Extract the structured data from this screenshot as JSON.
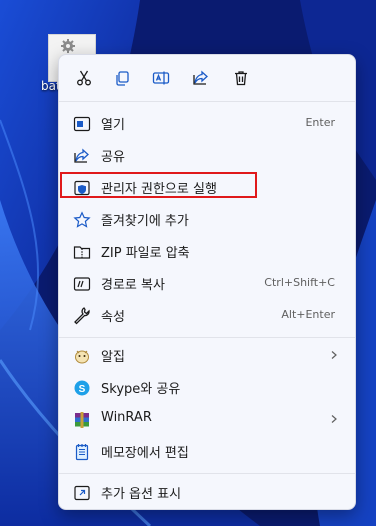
{
  "desktop": {
    "file_label": "bat",
    "file_icon": "gear-settings-file-icon"
  },
  "toolbar": [
    {
      "name": "cut",
      "icon": "scissors-icon"
    },
    {
      "name": "copy",
      "icon": "copy-icon"
    },
    {
      "name": "rename",
      "icon": "rename-icon"
    },
    {
      "name": "share",
      "icon": "share-icon"
    },
    {
      "name": "delete",
      "icon": "trash-icon"
    }
  ],
  "menu": {
    "open": {
      "label": "열기",
      "shortcut": "Enter",
      "icon": "open-app-icon"
    },
    "share": {
      "label": "공유",
      "icon": "share-icon"
    },
    "run_as_admin": {
      "label": "관리자 권한으로 실행",
      "icon": "shield-icon"
    },
    "add_favorites": {
      "label": "즐겨찾기에 추가",
      "icon": "star-icon"
    },
    "zip": {
      "label": "ZIP 파일로 압축",
      "icon": "zip-folder-icon"
    },
    "copy_path": {
      "label": "경로로 복사",
      "shortcut": "Ctrl+Shift+C",
      "icon": "path-icon"
    },
    "properties": {
      "label": "속성",
      "shortcut": "Alt+Enter",
      "icon": "wrench-icon"
    },
    "alzip": {
      "label": "알집",
      "icon": "alzip-icon"
    },
    "skype": {
      "label": "Skype와 공유",
      "icon": "skype-icon"
    },
    "winrar": {
      "label": "WinRAR",
      "icon": "winrar-icon"
    },
    "notepad": {
      "label": "메모장에서 편집",
      "icon": "notepad-icon"
    },
    "more_options": {
      "label": "추가 옵션 표시",
      "icon": "more-options-icon"
    }
  },
  "colors": {
    "menu_bg": "#f5f7fd",
    "accent_blue": "#1b5bc7",
    "highlight_red": "#e0191b"
  }
}
